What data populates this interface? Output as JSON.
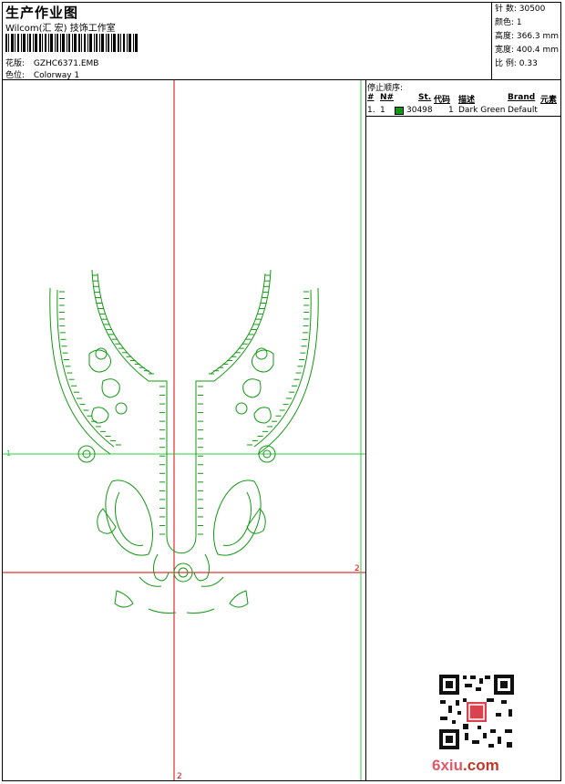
{
  "header": {
    "title": "生产作业图",
    "studio": "Wilcom(汇 宏) 技饰工作室",
    "design_label": "花版:",
    "design_value": "GZHC6371.EMB",
    "colorway_label": "色位:",
    "colorway_value": "Colorway 1"
  },
  "stats": {
    "stitches": "针 数: 30500",
    "colors": "颜色: 1",
    "height": "高度: 366.3 mm",
    "width": "宽度: 400.4 mm",
    "scale": "比 例: 0.33"
  },
  "stop_sequence": {
    "title": "停止顺序:",
    "columns": [
      "#",
      "N#",
      "St.",
      "代码",
      "描述",
      "Brand",
      "元素"
    ],
    "rows": [
      {
        "num": "1.",
        "n": "1",
        "color": "#129912",
        "stitches": "30498",
        "code": "1",
        "description": "Dark Green",
        "brand": "Default"
      }
    ]
  },
  "design": {
    "thread_color": "#129912",
    "guide_color": "#e00000",
    "axis_color": "#2ecc40",
    "marker_vertical": "2",
    "marker_horizontal": "2",
    "marker_left": "1"
  },
  "watermark": {
    "site_a": "6xiu",
    "site_b": ".com"
  }
}
